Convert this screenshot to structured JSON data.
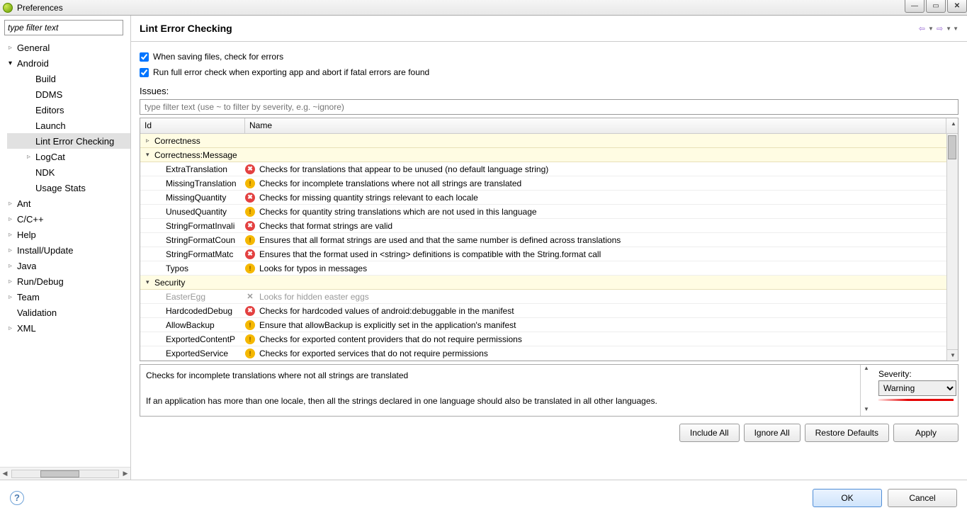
{
  "window": {
    "title": "Preferences"
  },
  "sidebar": {
    "filter_placeholder": "type filter text",
    "items": [
      {
        "label": "General",
        "expanded": false,
        "children": []
      },
      {
        "label": "Android",
        "expanded": true,
        "children": [
          {
            "label": "Build"
          },
          {
            "label": "DDMS"
          },
          {
            "label": "Editors"
          },
          {
            "label": "Launch"
          },
          {
            "label": "Lint Error Checking",
            "selected": true
          },
          {
            "label": "LogCat",
            "hasChildren": true
          },
          {
            "label": "NDK"
          },
          {
            "label": "Usage Stats"
          }
        ]
      },
      {
        "label": "Ant",
        "expanded": false
      },
      {
        "label": "C/C++",
        "expanded": false
      },
      {
        "label": "Help",
        "expanded": false
      },
      {
        "label": "Install/Update",
        "expanded": false
      },
      {
        "label": "Java",
        "expanded": false
      },
      {
        "label": "Run/Debug",
        "expanded": false
      },
      {
        "label": "Team",
        "expanded": false
      },
      {
        "label": "Validation"
      },
      {
        "label": "XML",
        "expanded": false
      }
    ]
  },
  "page": {
    "title": "Lint Error Checking",
    "check1": "When saving files, check for errors",
    "check2": "Run full error check when exporting app and abort if fatal errors are found",
    "issues_label": "Issues:",
    "issues_filter_placeholder": "type filter text (use ~ to filter by severity, e.g. ~ignore)",
    "columns": {
      "id": "Id",
      "name": "Name"
    },
    "rows": [
      {
        "type": "group",
        "id": "Correctness",
        "expanded": false
      },
      {
        "type": "group",
        "id": "Correctness:Message",
        "expanded": true
      },
      {
        "type": "item",
        "id": "ExtraTranslation",
        "sev": "error",
        "name": "Checks for translations that appear to be unused (no default language string)"
      },
      {
        "type": "item",
        "id": "MissingTranslation",
        "sev": "warning",
        "name": "Checks for incomplete translations where not all strings are translated"
      },
      {
        "type": "item",
        "id": "MissingQuantity",
        "sev": "error",
        "name": "Checks for missing quantity strings relevant to each locale"
      },
      {
        "type": "item",
        "id": "UnusedQuantity",
        "sev": "warning",
        "name": "Checks for quantity string translations which are not used in this language"
      },
      {
        "type": "item",
        "id": "StringFormatInvali",
        "sev": "error",
        "name": "Checks that format strings are valid"
      },
      {
        "type": "item",
        "id": "StringFormatCoun",
        "sev": "warning",
        "name": "Ensures that all format strings are used and that the same number is defined across translations"
      },
      {
        "type": "item",
        "id": "StringFormatMatc",
        "sev": "error",
        "name": "Ensures that the format used in <string> definitions is compatible with the String.format call"
      },
      {
        "type": "item",
        "id": "Typos",
        "sev": "warning",
        "name": "Looks for typos in messages"
      },
      {
        "type": "group",
        "id": "Security",
        "expanded": true
      },
      {
        "type": "item",
        "id": "EasterEgg",
        "sev": "disabled",
        "name": "Looks for hidden easter eggs"
      },
      {
        "type": "item",
        "id": "HardcodedDebug",
        "sev": "error",
        "name": "Checks for hardcoded values of android:debuggable in the manifest"
      },
      {
        "type": "item",
        "id": "AllowBackup",
        "sev": "warning",
        "name": "Ensure that allowBackup is explicitly set in the application's manifest"
      },
      {
        "type": "item",
        "id": "ExportedContentP",
        "sev": "warning",
        "name": "Checks for exported content providers that do not require permissions"
      },
      {
        "type": "item",
        "id": "ExportedService",
        "sev": "warning",
        "name": "Checks for exported services that do not require permissions"
      }
    ],
    "description": {
      "line1": "Checks for incomplete translations where not all strings are translated",
      "line2": "If an application has more than one locale, then all the strings declared in one language should also be translated in all other languages."
    },
    "severity_label": "Severity:",
    "severity_value": "Warning",
    "buttons": {
      "include_all": "Include All",
      "ignore_all": "Ignore All",
      "restore": "Restore Defaults",
      "apply": "Apply",
      "ok": "OK",
      "cancel": "Cancel"
    }
  }
}
